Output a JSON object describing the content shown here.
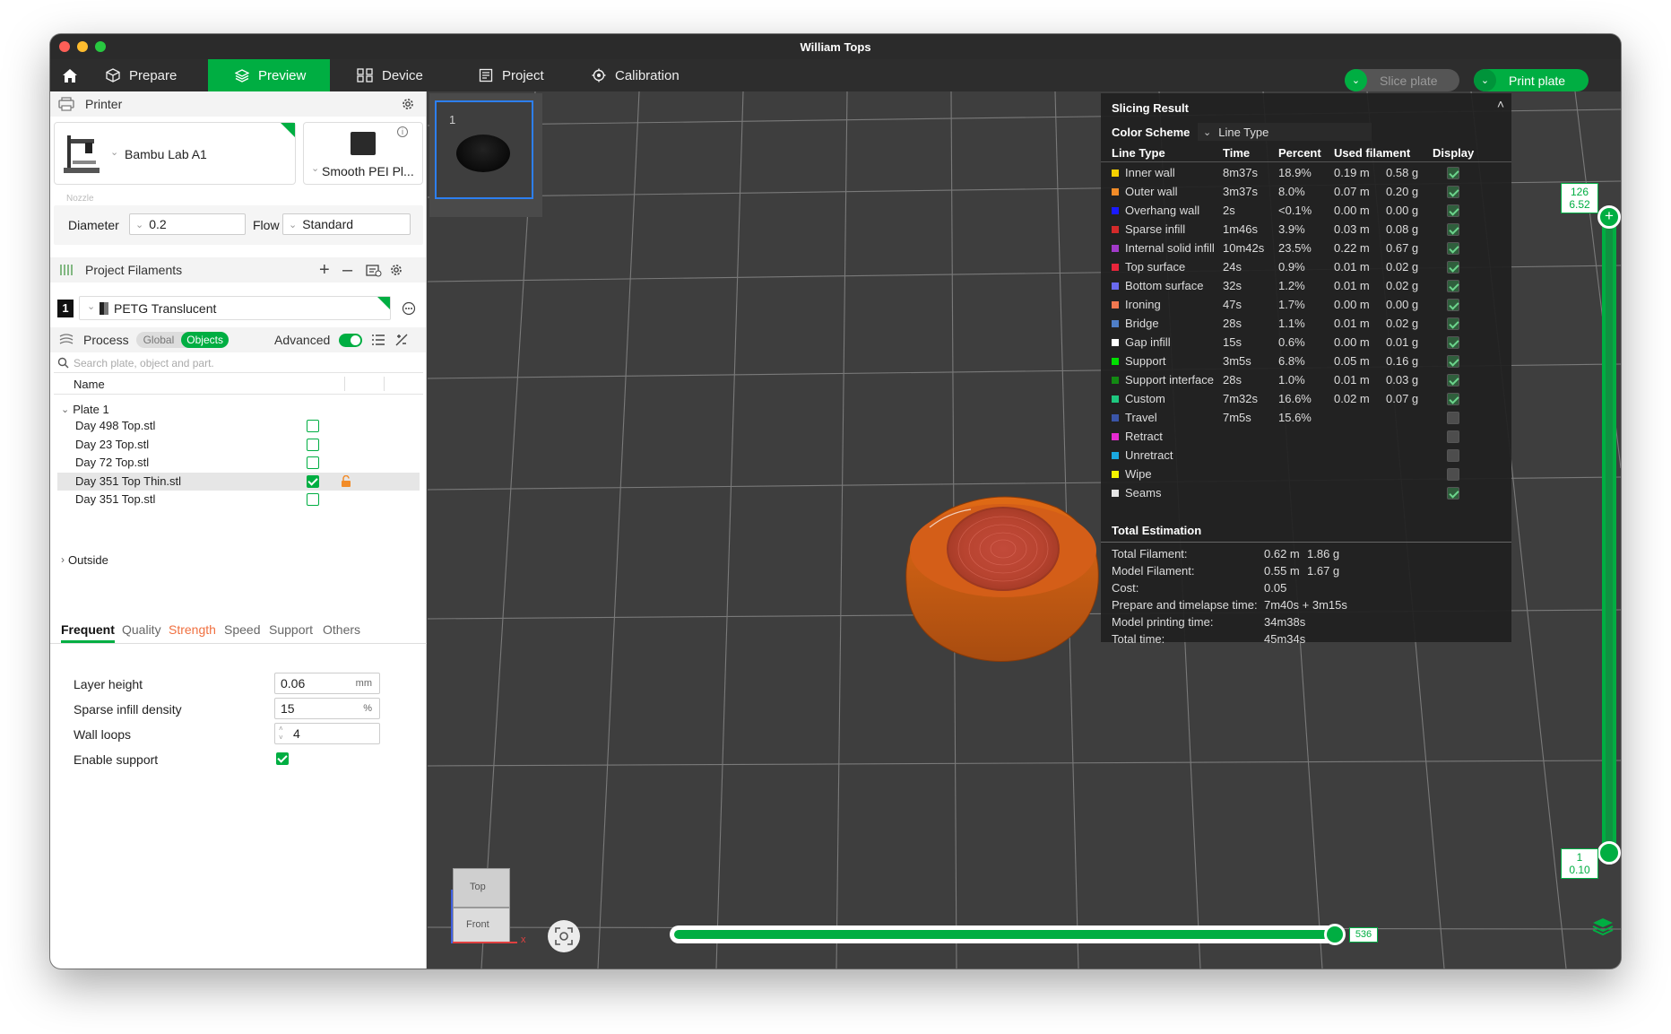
{
  "window": {
    "title": "William Tops"
  },
  "menu": {
    "prepare": "Prepare",
    "preview": "Preview",
    "device": "Device",
    "project": "Project",
    "calibration": "Calibration",
    "slice_plate": "Slice plate",
    "print_plate": "Print plate"
  },
  "printer": {
    "title": "Printer",
    "model": "Bambu Lab A1",
    "plate": "Smooth PEI Pl...",
    "nozzle_label": "Nozzle",
    "diameter_label": "Diameter",
    "diameter_value": "0.2",
    "flow_label": "Flow",
    "flow_value": "Standard"
  },
  "filaments": {
    "title": "Project Filaments",
    "items": [
      {
        "index": "1",
        "name": "PETG Translucent"
      }
    ]
  },
  "process": {
    "title": "Process",
    "global_label": "Global",
    "objects_label": "Objects",
    "advanced_label": "Advanced",
    "search_placeholder": "Search plate, object and part.",
    "name_header": "Name",
    "plate_label": "Plate 1",
    "objects": [
      {
        "name": "Day 498 Top.stl",
        "checked": false
      },
      {
        "name": "Day 23 Top.stl",
        "checked": false
      },
      {
        "name": "Day 72 Top.stl",
        "checked": false
      },
      {
        "name": "Day 351 Top Thin.stl",
        "checked": true,
        "selected": true
      },
      {
        "name": "Day 351 Top.stl",
        "checked": false
      }
    ],
    "outside_label": "Outside"
  },
  "settings_tabs": [
    "Frequent",
    "Quality",
    "Strength",
    "Speed",
    "Support",
    "Others"
  ],
  "settings": {
    "layer_height_label": "Layer height",
    "layer_height_value": "0.06",
    "layer_height_unit": "mm",
    "sparse_label": "Sparse infill density",
    "sparse_value": "15",
    "sparse_unit": "%",
    "wall_loops_label": "Wall loops",
    "wall_loops_value": "4",
    "support_label": "Enable support"
  },
  "plate_thumb": {
    "number": "1"
  },
  "slicing": {
    "title": "Slicing Result",
    "color_scheme_label": "Color Scheme",
    "color_scheme_value": "Line Type",
    "headers": [
      "Line Type",
      "Time",
      "Percent",
      "Used filament",
      "Display"
    ],
    "rows": [
      {
        "name": "Inner wall",
        "color": "#f5d000",
        "time": "8m37s",
        "percent": "18.9%",
        "len": "0.19 m",
        "weight": "0.58 g",
        "display": true
      },
      {
        "name": "Outer wall",
        "color": "#f28c28",
        "time": "3m37s",
        "percent": "8.0%",
        "len": "0.07 m",
        "weight": "0.20 g",
        "display": true
      },
      {
        "name": "Overhang wall",
        "color": "#1a1aff",
        "time": "2s",
        "percent": "<0.1%",
        "len": "0.00 m",
        "weight": "0.00 g",
        "display": true
      },
      {
        "name": "Sparse infill",
        "color": "#d42a2a",
        "time": "1m46s",
        "percent": "3.9%",
        "len": "0.03 m",
        "weight": "0.08 g",
        "display": true
      },
      {
        "name": "Internal solid infill",
        "color": "#a23ac9",
        "time": "10m42s",
        "percent": "23.5%",
        "len": "0.22 m",
        "weight": "0.67 g",
        "display": true
      },
      {
        "name": "Top surface",
        "color": "#e8253a",
        "time": "24s",
        "percent": "0.9%",
        "len": "0.01 m",
        "weight": "0.02 g",
        "display": true
      },
      {
        "name": "Bottom surface",
        "color": "#6a6af0",
        "time": "32s",
        "percent": "1.2%",
        "len": "0.01 m",
        "weight": "0.02 g",
        "display": true
      },
      {
        "name": "Ironing",
        "color": "#f07850",
        "time": "47s",
        "percent": "1.7%",
        "len": "0.00 m",
        "weight": "0.00 g",
        "display": true
      },
      {
        "name": "Bridge",
        "color": "#4f7fc8",
        "time": "28s",
        "percent": "1.1%",
        "len": "0.01 m",
        "weight": "0.02 g",
        "display": true
      },
      {
        "name": "Gap infill",
        "color": "#ffffff",
        "time": "15s",
        "percent": "0.6%",
        "len": "0.00 m",
        "weight": "0.01 g",
        "display": true
      },
      {
        "name": "Support",
        "color": "#00e000",
        "time": "3m5s",
        "percent": "6.8%",
        "len": "0.05 m",
        "weight": "0.16 g",
        "display": true
      },
      {
        "name": "Support interface",
        "color": "#138a13",
        "time": "28s",
        "percent": "1.0%",
        "len": "0.01 m",
        "weight": "0.03 g",
        "display": true
      },
      {
        "name": "Custom",
        "color": "#1ec77f",
        "time": "7m32s",
        "percent": "16.6%",
        "len": "0.02 m",
        "weight": "0.07 g",
        "display": true
      },
      {
        "name": "Travel",
        "color": "#3a55a8",
        "time": "7m5s",
        "percent": "15.6%",
        "len": "",
        "weight": "",
        "display": false
      },
      {
        "name": "Retract",
        "color": "#e52ad0",
        "time": "",
        "percent": "",
        "len": "",
        "weight": "",
        "display": false
      },
      {
        "name": "Unretract",
        "color": "#1aa8e0",
        "time": "",
        "percent": "",
        "len": "",
        "weight": "",
        "display": false
      },
      {
        "name": "Wipe",
        "color": "#f5f500",
        "time": "",
        "percent": "",
        "len": "",
        "weight": "",
        "display": false
      },
      {
        "name": "Seams",
        "color": "#e6e6e6",
        "time": "",
        "percent": "",
        "len": "",
        "weight": "",
        "display": true
      }
    ],
    "total_title": "Total Estimation",
    "totals": [
      {
        "label": "Total Filament:",
        "v1": "0.62 m",
        "v2": "1.86 g"
      },
      {
        "label": "Model Filament:",
        "v1": "0.55 m",
        "v2": "1.67 g"
      },
      {
        "label": "Cost:",
        "v1": "0.05",
        "v2": ""
      },
      {
        "label": "Prepare and timelapse time:",
        "v1": "7m40s + 3m15s",
        "v2": ""
      },
      {
        "label": "Model printing time:",
        "v1": "34m38s",
        "v2": ""
      },
      {
        "label": "Total time:",
        "v1": "45m34s",
        "v2": ""
      }
    ]
  },
  "layer_slider": {
    "top_layer": "126",
    "top_height": "6.52",
    "bottom_layer": "1",
    "bottom_height": "0.10"
  },
  "move_slider": {
    "value": "536"
  },
  "view_cube": {
    "top": "Top",
    "front": "Front",
    "x_axis": "x"
  }
}
